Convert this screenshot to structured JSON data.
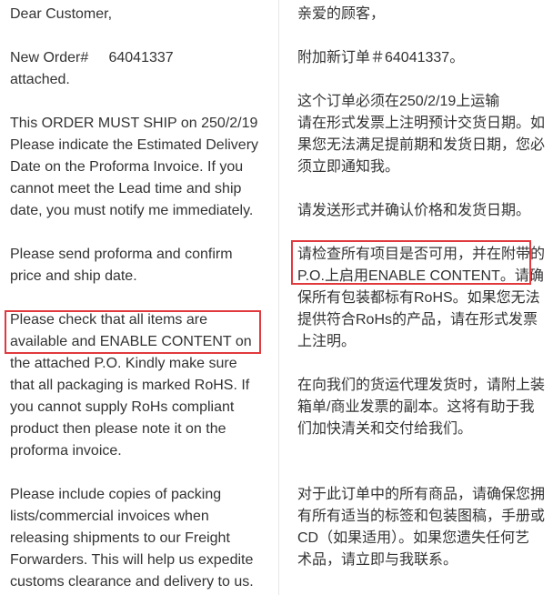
{
  "english": {
    "lines": [
      "Dear Customer,",
      "",
      "New Order#     64041337",
      "attached.",
      "",
      "This ORDER MUST SHIP on 250/2/19",
      "Please indicate the Estimated Delivery",
      "Date on the Proforma Invoice. If you",
      "cannot meet the Lead time and ship",
      "date, you must notify me immediately.",
      "",
      "Please send proforma and confirm",
      "price and ship date.",
      "",
      "Please check that all items are",
      "available and ENABLE CONTENT on",
      "the attached P.O. Kindly make sure",
      "that all packaging is marked RoHS. If",
      "you cannot supply RoHs compliant",
      "product then please note it on the",
      "proforma invoice.",
      "",
      "Please include copies of packing",
      "lists/commercial invoices when",
      "releasing shipments to our Freight",
      "Forwarders. This will help us expedite",
      "customs clearance and delivery to us."
    ]
  },
  "chinese": {
    "lines": [
      "亲爱的顾客，",
      "",
      "附加新订单＃64041337。",
      "",
      "这个订单必须在250/2/19上运输",
      "请在形式发票上注明预计交货日期。如",
      "果您无法满足提前期和发货日期，您必",
      "须立即通知我。",
      "",
      "请发送形式并确认价格和发货日期。",
      "",
      "请检查所有项目是否可用，并在附带的",
      "P.O.上启用ENABLE CONTENT。请确",
      "保所有包装都标有RoHS。如果您无法",
      "提供符合RoHs的产品，请在形式发票",
      "上注明。",
      "",
      "在向我们的货运代理发货时，请附上装",
      "箱单/商业发票的副本。这将有助于我",
      "们加快清关和交付给我们。",
      "",
      "",
      "对于此订单中的所有商品，请确保您拥",
      "有所有适当的标签和包装图稿，手册或",
      "CD（如果适用）。如果您遗失任何艺",
      "术品，请立即与我联系。"
    ]
  },
  "highlight_color": "#e03a3e"
}
